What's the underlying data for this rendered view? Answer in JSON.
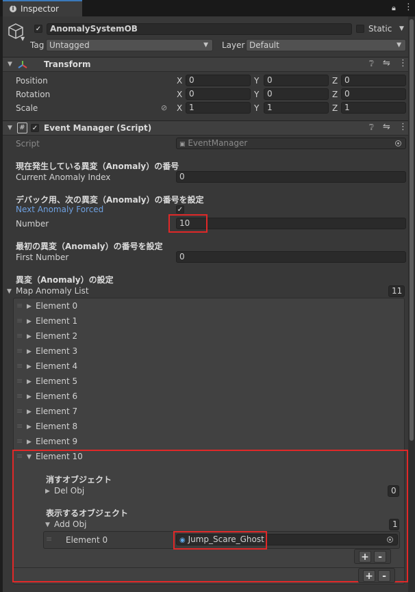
{
  "tab": {
    "title": "Inspector"
  },
  "header": {
    "object_name": "AnomalySystemOB",
    "static_label": "Static",
    "tag_label": "Tag",
    "tag_value": "Untagged",
    "layer_label": "Layer",
    "layer_value": "Default"
  },
  "transform": {
    "title": "Transform",
    "rows": [
      {
        "label": "Position",
        "x": "0",
        "y": "0",
        "z": "0"
      },
      {
        "label": "Rotation",
        "x": "0",
        "y": "0",
        "z": "0"
      },
      {
        "label": "Scale",
        "x": "1",
        "y": "1",
        "z": "1"
      }
    ],
    "axis_x": "X",
    "axis_y": "Y",
    "axis_z": "Z"
  },
  "event_manager": {
    "title": "Event Manager (Script)",
    "script_label": "Script",
    "script_value": "EventManager",
    "header1": "現在発生している異変（Anomaly）の番号",
    "current_label": "Current Anomaly Index",
    "current_value": "0",
    "header2": "デバック用、次の異変（Anomaly）の番号を設定",
    "forced_label": "Next Anomaly Forced",
    "forced_checked": true,
    "number_label": "Number",
    "number_value": "10",
    "header3": "最初の異変（Anomaly）の番号を設定",
    "first_label": "First Number",
    "first_value": "0",
    "header4": "異変（Anomaly）の設定",
    "list_label": "Map Anomaly List",
    "list_count": "11",
    "elements": [
      "Element 0",
      "Element 1",
      "Element 2",
      "Element 3",
      "Element 4",
      "Element 5",
      "Element 6",
      "Element 7",
      "Element 8",
      "Element 9"
    ],
    "expanded": {
      "label": "Element 10",
      "del_header": "消すオブジェクト",
      "del_label": "Del Obj",
      "del_count": "0",
      "add_header": "表示するオブジェクト",
      "add_label": "Add Obj",
      "add_count": "1",
      "add_element_label": "Element 0",
      "add_element_value": "Jump_Scare_Ghost"
    }
  },
  "colors": {
    "accent": "#3a79bb",
    "highlight": "#e12828",
    "link": "#6ea0e0"
  }
}
